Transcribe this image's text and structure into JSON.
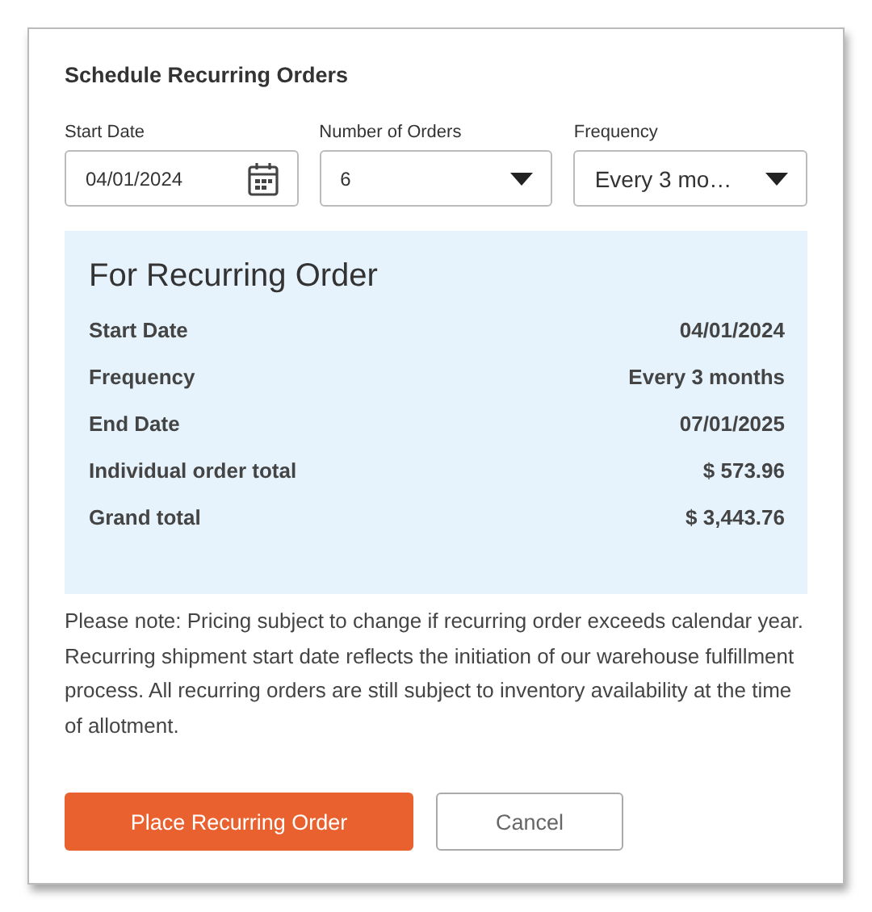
{
  "dialog": {
    "title": "Schedule Recurring Orders"
  },
  "fields": [
    {
      "kind": "date",
      "label": "Start Date",
      "value": "04/01/2024"
    },
    {
      "kind": "select",
      "label": "Number of Orders",
      "value": "6"
    },
    {
      "kind": "select",
      "label": "Frequency",
      "value": "Every 3 mo…"
    }
  ],
  "summary": {
    "title": "For Recurring Order",
    "rows": [
      {
        "label": "Start Date",
        "value": "04/01/2024"
      },
      {
        "label": "Frequency",
        "value": "Every 3 months"
      },
      {
        "label": "End Date",
        "value": "07/01/2025"
      },
      {
        "label": "Individual order total",
        "value": "$ 573.96"
      },
      {
        "label": "Grand total",
        "value": "$ 3,443.76"
      }
    ]
  },
  "note": "Please note: Pricing subject to change if recurring order exceeds calendar year. Recurring shipment start date reflects the initiation of our warehouse fulfillment process. All recurring orders are still subject to inventory availability at the time of allotment.",
  "buttons": [
    {
      "kind": "primary",
      "label": "Place Recurring Order"
    },
    {
      "kind": "secondary",
      "label": "Cancel"
    }
  ]
}
